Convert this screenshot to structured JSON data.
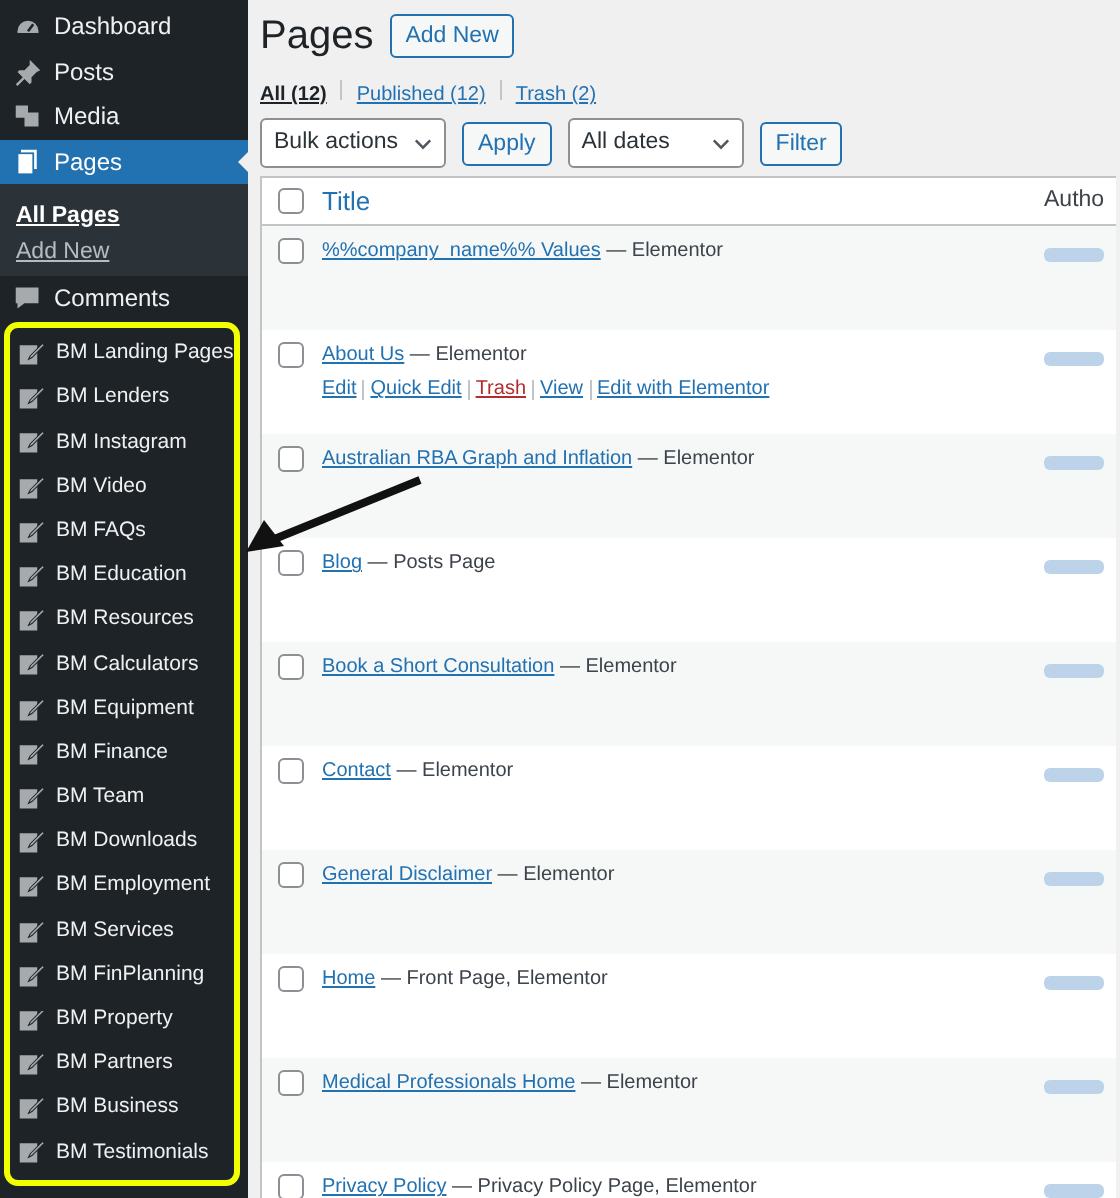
{
  "sidebar": {
    "items": [
      {
        "label": "Dashboard",
        "kind": "dashboard",
        "selected": false
      },
      {
        "label": "Posts",
        "kind": "pin",
        "selected": false
      },
      {
        "label": "Media",
        "kind": "media",
        "selected": false
      },
      {
        "label": "Pages",
        "kind": "pages",
        "selected": true,
        "submenu": [
          {
            "label": "All Pages",
            "selected": true
          },
          {
            "label": "Add New",
            "selected": false
          }
        ]
      },
      {
        "label": "Comments",
        "kind": "comments",
        "selected": false
      }
    ],
    "highlighted_items": [
      {
        "label": "BM Landing Pages"
      },
      {
        "label": "BM Lenders"
      },
      {
        "label": "BM Instagram"
      },
      {
        "label": "BM Video"
      },
      {
        "label": "BM FAQs"
      },
      {
        "label": "BM Education"
      },
      {
        "label": "BM Resources"
      },
      {
        "label": "BM Calculators"
      },
      {
        "label": "BM Equipment"
      },
      {
        "label": "BM Finance"
      },
      {
        "label": "BM Team"
      },
      {
        "label": "BM Downloads"
      },
      {
        "label": "BM Employment"
      },
      {
        "label": "BM Services"
      },
      {
        "label": "BM FinPlanning"
      },
      {
        "label": "BM Property"
      },
      {
        "label": "BM Partners"
      },
      {
        "label": "BM Business"
      },
      {
        "label": "BM Testimonials"
      }
    ]
  },
  "main": {
    "title": "Pages",
    "add_new": "Add New",
    "views": [
      {
        "label": "All",
        "count": "(12)",
        "selected": true
      },
      {
        "label": "Published",
        "count": "(12)",
        "selected": false
      },
      {
        "label": "Trash",
        "count": "(2)",
        "selected": false
      }
    ],
    "bulk_actions": "Bulk actions",
    "apply": "Apply",
    "dates": "All dates",
    "filter": "Filter",
    "table": {
      "columns": [
        "Title",
        "Autho"
      ],
      "select_all_checked": false,
      "rows": [
        {
          "title": "%%company_name%% Values",
          "state": "— Elementor",
          "checked": false
        },
        {
          "title": "About Us",
          "state": "— Elementor",
          "checked": false,
          "actions": [
            {
              "label": "Edit",
              "kind": "link"
            },
            {
              "label": "Quick Edit",
              "kind": "link"
            },
            {
              "label": "Trash",
              "kind": "delete"
            },
            {
              "label": "View",
              "kind": "link"
            },
            {
              "label": "Edit with Elementor",
              "kind": "link"
            }
          ]
        },
        {
          "title": "Australian RBA Graph and Inflation",
          "state": "— Elementor",
          "checked": false
        },
        {
          "title": "Blog",
          "state": "— Posts Page",
          "checked": false
        },
        {
          "title": "Book a Short Consultation",
          "state": "— Elementor",
          "checked": false
        },
        {
          "title": "Contact",
          "state": "— Elementor",
          "checked": false
        },
        {
          "title": "General Disclaimer",
          "state": "— Elementor",
          "checked": false
        },
        {
          "title": "Home",
          "state": "— Front Page, Elementor",
          "checked": false
        },
        {
          "title": "Medical Professionals Home",
          "state": "— Elementor",
          "checked": false
        },
        {
          "title": "Privacy Policy",
          "state": "— Privacy Policy Page, Elementor",
          "checked": false
        }
      ]
    }
  }
}
